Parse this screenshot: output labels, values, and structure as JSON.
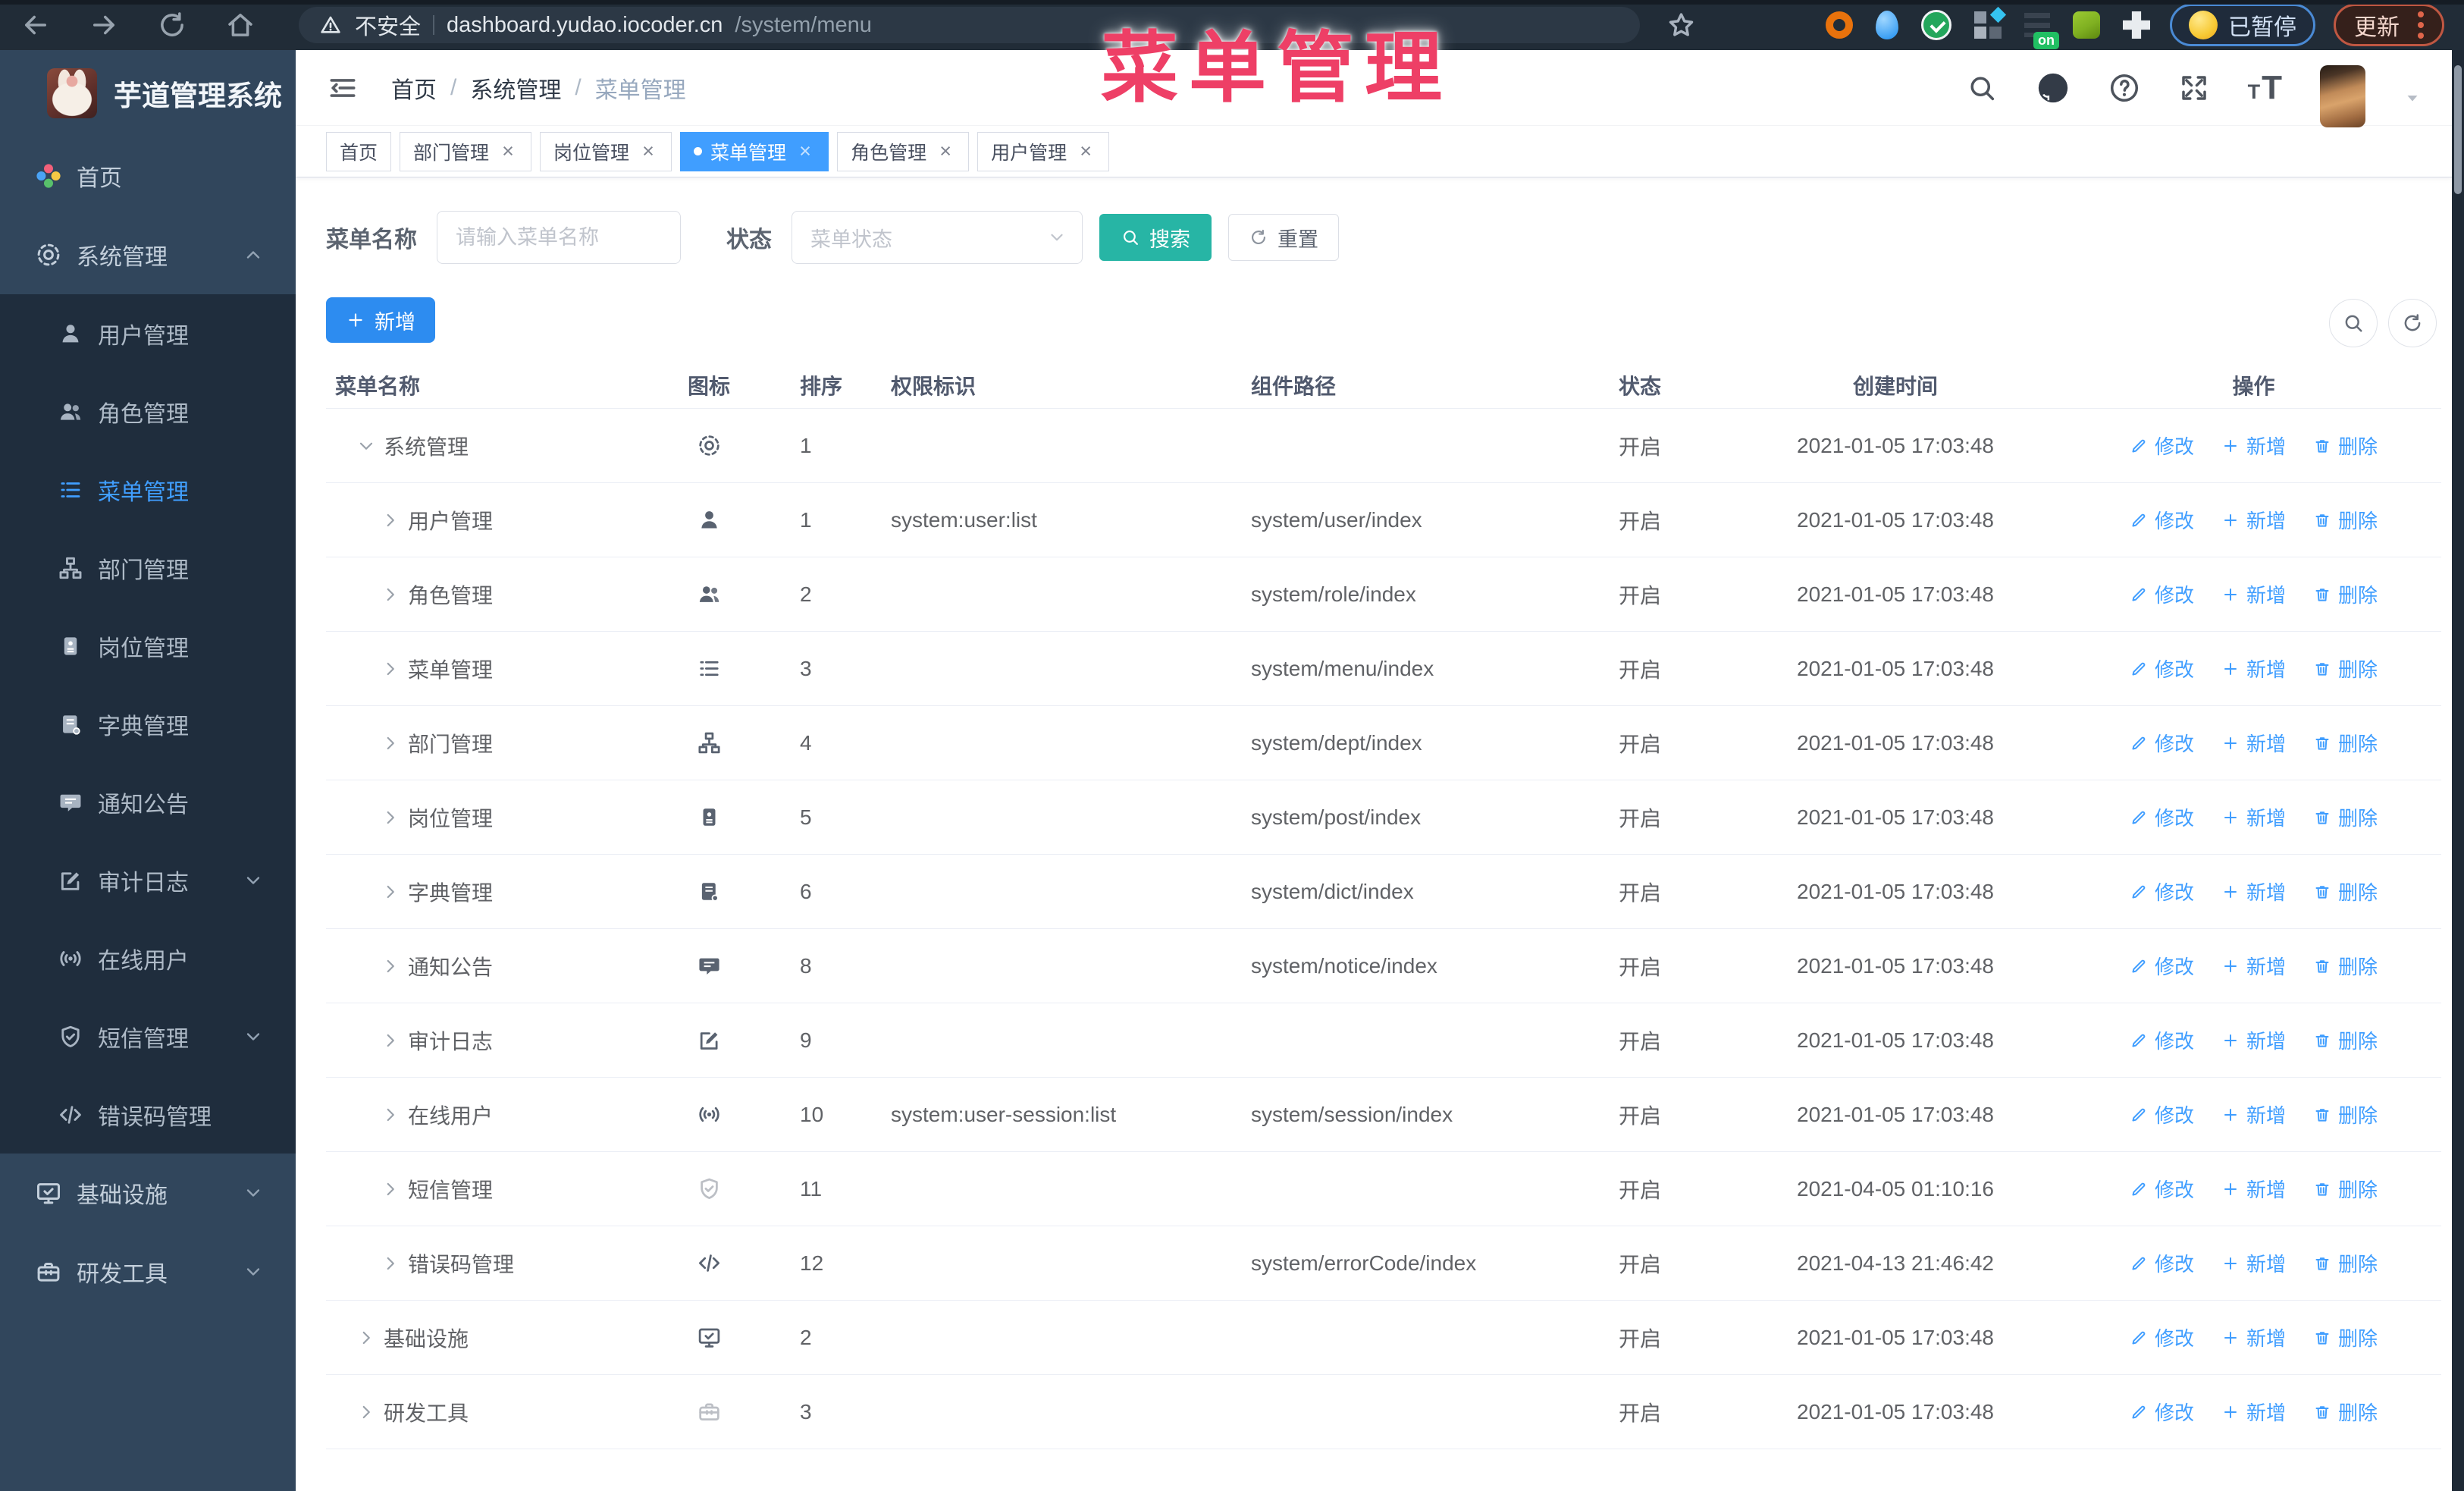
{
  "browser": {
    "security_label": "不安全",
    "url_host": "dashboard.yudao.iocoder.cn",
    "url_path": "/system/menu",
    "paused_badge": "已暂停",
    "update_label": "更新"
  },
  "annotation": {
    "title": "菜单管理"
  },
  "sidebar": {
    "logo_title": "芋道管理系统",
    "items": [
      {
        "label": "首页",
        "icon": "home-colorful-icon",
        "type": "top"
      },
      {
        "label": "系统管理",
        "icon": "gear-icon",
        "type": "top",
        "chevron": "up",
        "expanded": true
      },
      {
        "label": "用户管理",
        "icon": "user-icon",
        "type": "sub"
      },
      {
        "label": "角色管理",
        "icon": "users-icon",
        "type": "sub"
      },
      {
        "label": "菜单管理",
        "icon": "menu-icon",
        "type": "sub",
        "active": true
      },
      {
        "label": "部门管理",
        "icon": "tree-icon",
        "type": "sub"
      },
      {
        "label": "岗位管理",
        "icon": "badge-icon",
        "type": "sub"
      },
      {
        "label": "字典管理",
        "icon": "book-icon",
        "type": "sub"
      },
      {
        "label": "通知公告",
        "icon": "message-icon",
        "type": "sub"
      },
      {
        "label": "审计日志",
        "icon": "edit-doc-icon",
        "type": "sub",
        "chevron": "down"
      },
      {
        "label": "在线用户",
        "icon": "online-icon",
        "type": "sub"
      },
      {
        "label": "短信管理",
        "icon": "shield-check-icon",
        "type": "sub",
        "chevron": "down"
      },
      {
        "label": "错误码管理",
        "icon": "code-icon",
        "type": "sub"
      },
      {
        "label": "基础设施",
        "icon": "monitor-icon",
        "type": "top",
        "chevron": "down"
      },
      {
        "label": "研发工具",
        "icon": "toolbox-icon",
        "type": "top",
        "chevron": "down"
      }
    ]
  },
  "header": {
    "breadcrumb": [
      "首页",
      "系统管理",
      "菜单管理"
    ]
  },
  "tabs": [
    {
      "label": "首页"
    },
    {
      "label": "部门管理",
      "closable": true
    },
    {
      "label": "岗位管理",
      "closable": true
    },
    {
      "label": "菜单管理",
      "closable": true,
      "active": true
    },
    {
      "label": "角色管理",
      "closable": true
    },
    {
      "label": "用户管理",
      "closable": true
    }
  ],
  "filters": {
    "name_label": "菜单名称",
    "name_placeholder": "请输入菜单名称",
    "status_label": "状态",
    "status_placeholder": "菜单状态",
    "search_label": "搜索",
    "reset_label": "重置"
  },
  "toolbar": {
    "add_label": "新增"
  },
  "table": {
    "columns": [
      "菜单名称",
      "图标",
      "排序",
      "权限标识",
      "组件路径",
      "状态",
      "创建时间",
      "操作"
    ],
    "action_labels": {
      "edit": "修改",
      "add": "新增",
      "delete": "删除"
    },
    "rows": [
      {
        "name": "系统管理",
        "level": 0,
        "expanded": true,
        "icon": "gear-icon",
        "sort": "1",
        "perm": "",
        "path": "",
        "status": "开启",
        "time": "2021-01-05 17:03:48"
      },
      {
        "name": "用户管理",
        "level": 1,
        "icon": "user-icon",
        "sort": "1",
        "perm": "system:user:list",
        "path": "system/user/index",
        "status": "开启",
        "time": "2021-01-05 17:03:48"
      },
      {
        "name": "角色管理",
        "level": 1,
        "icon": "users-icon",
        "sort": "2",
        "perm": "",
        "path": "system/role/index",
        "status": "开启",
        "time": "2021-01-05 17:03:48"
      },
      {
        "name": "菜单管理",
        "level": 1,
        "icon": "menu-icon",
        "sort": "3",
        "perm": "",
        "path": "system/menu/index",
        "status": "开启",
        "time": "2021-01-05 17:03:48"
      },
      {
        "name": "部门管理",
        "level": 1,
        "icon": "tree-icon",
        "sort": "4",
        "perm": "",
        "path": "system/dept/index",
        "status": "开启",
        "time": "2021-01-05 17:03:48"
      },
      {
        "name": "岗位管理",
        "level": 1,
        "icon": "badge-icon",
        "sort": "5",
        "perm": "",
        "path": "system/post/index",
        "status": "开启",
        "time": "2021-01-05 17:03:48"
      },
      {
        "name": "字典管理",
        "level": 1,
        "icon": "book-icon",
        "sort": "6",
        "perm": "",
        "path": "system/dict/index",
        "status": "开启",
        "time": "2021-01-05 17:03:48"
      },
      {
        "name": "通知公告",
        "level": 1,
        "icon": "message-icon",
        "sort": "8",
        "perm": "",
        "path": "system/notice/index",
        "status": "开启",
        "time": "2021-01-05 17:03:48"
      },
      {
        "name": "审计日志",
        "level": 1,
        "icon": "edit-doc-icon",
        "sort": "9",
        "perm": "",
        "path": "",
        "status": "开启",
        "time": "2021-01-05 17:03:48"
      },
      {
        "name": "在线用户",
        "level": 1,
        "icon": "online-icon",
        "sort": "10",
        "perm": "system:user-session:list",
        "path": "system/session/index",
        "status": "开启",
        "time": "2021-01-05 17:03:48"
      },
      {
        "name": "短信管理",
        "level": 1,
        "icon": "shield-check-icon",
        "muted": true,
        "sort": "11",
        "perm": "",
        "path": "",
        "status": "开启",
        "time": "2021-04-05 01:10:16"
      },
      {
        "name": "错误码管理",
        "level": 1,
        "icon": "code-icon",
        "sort": "12",
        "perm": "",
        "path": "system/errorCode/index",
        "status": "开启",
        "time": "2021-04-13 21:46:42"
      },
      {
        "name": "基础设施",
        "level": 0,
        "icon": "monitor-icon",
        "sort": "2",
        "perm": "",
        "path": "",
        "status": "开启",
        "time": "2021-01-05 17:03:48"
      },
      {
        "name": "研发工具",
        "level": 0,
        "icon": "toolbox-icon",
        "muted": true,
        "sort": "3",
        "perm": "",
        "path": "",
        "status": "开启",
        "time": "2021-01-05 17:03:48"
      }
    ]
  },
  "colors": {
    "primary": "#409eff",
    "search_button": "#27b5a5",
    "add_button": "#2d8cf0",
    "annotation": "#ee3f66",
    "sidebar_bg": "#31465c",
    "submenu_bg": "#1f2d3d"
  }
}
